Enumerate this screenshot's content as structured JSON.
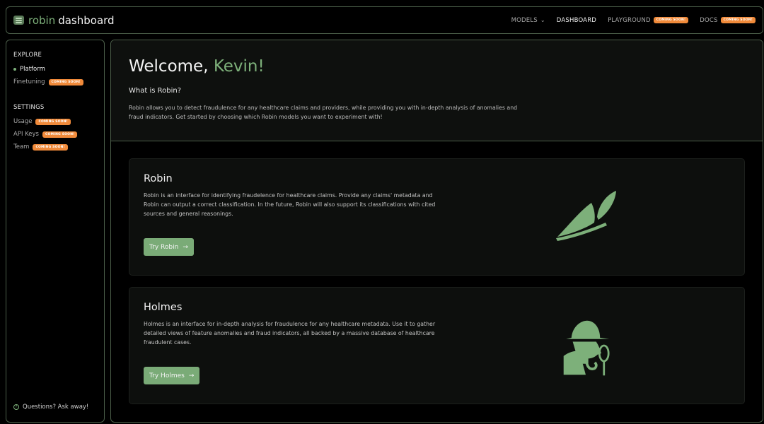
{
  "header": {
    "brand_primary": "robin",
    "brand_secondary": "dashboard",
    "nav": [
      {
        "label": "MODELS",
        "has_dropdown": true
      },
      {
        "label": "DASHBOARD",
        "active": true
      },
      {
        "label": "PLAYGROUND",
        "badge": "COMING SOON!"
      },
      {
        "label": "DOCS",
        "badge": "COMING SOON!"
      }
    ]
  },
  "sidebar": {
    "explore_heading": "EXPLORE",
    "explore_items": [
      {
        "label": "Platform",
        "active": true
      },
      {
        "label": "Finetuning",
        "badge": "COMING SOON!"
      }
    ],
    "settings_heading": "SETTINGS",
    "settings_items": [
      {
        "label": "Usage",
        "badge": "COMING SOON!"
      },
      {
        "label": "API Keys",
        "badge": "COMING SOON!"
      },
      {
        "label": "Team",
        "badge": "COMING SOON!"
      }
    ],
    "help_label": "Questions? Ask away!",
    "help_icon": "?"
  },
  "main": {
    "welcome_prefix": "Welcome, ",
    "welcome_name": "Kevin!",
    "section_heading": "What is Robin?",
    "intro": "Robin allows you to detect fraudulence for any healthcare claims and providers, while providing you with in-depth analysis of anomalies and fraud indicators. Get started by choosing which Robin models you want to experiment with!",
    "cards": [
      {
        "title": "Robin",
        "description": "Robin is an interface for identifying fraudelence for healthcare claims. Provide any claims' metadata and Robin can output a correct classification. In the future, Robin will also support its classifications with cited sources and general reasonings.",
        "button": "Try Robin",
        "icon": "robin-hood-hat"
      },
      {
        "title": "Holmes",
        "description": "Holmes is an interface for in-depth analysis for fraudulence for any healthcare metadata. Use it to gather detailed views of feature anomalies and fraud indicators, all backed by a massive database of healthcare fraudulent cases.",
        "button": "Try Holmes",
        "icon": "detective-with-magnifier"
      }
    ],
    "arrow": "→"
  },
  "colors": {
    "accent": "#7db07a",
    "badge": "#f08a3a",
    "border": "#4b5e49"
  }
}
